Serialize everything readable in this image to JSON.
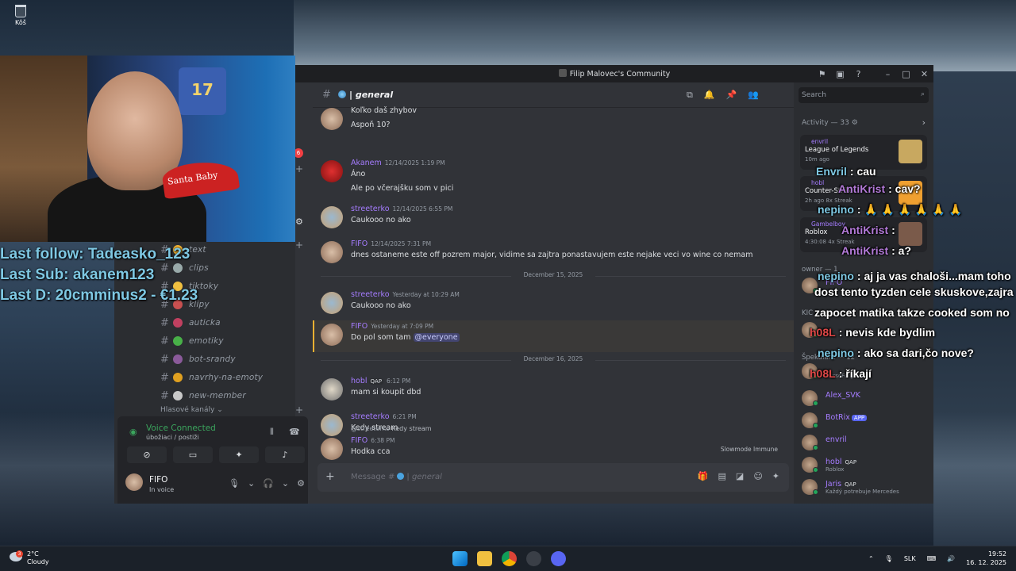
{
  "desktop": {
    "bin_label": "Kôš"
  },
  "webcam": {
    "hat_text": "Santa Baby",
    "shirt_number": "17"
  },
  "stream_overlay": {
    "last_follow": "Last follow: Tadeasko_123",
    "last_sub": "Last Sub: akanem123",
    "last_d": "Last D: 20cmminus2 - €1.23"
  },
  "window": {
    "title": "Filip Malovec's Community"
  },
  "channels": [
    {
      "name": "text",
      "color": "#f0b132"
    },
    {
      "name": "clips",
      "color": "#9aa"
    },
    {
      "name": "tiktoky",
      "color": "#f0c040"
    },
    {
      "name": "klipy",
      "color": "#c85050"
    },
    {
      "name": "auticka",
      "color": "#c04060"
    },
    {
      "name": "emotiky",
      "color": "#48b048"
    },
    {
      "name": "bot-srandy",
      "color": "#8a5a9a"
    },
    {
      "name": "navrhy-na-emoty",
      "color": "#e0a020"
    },
    {
      "name": "new-member",
      "color": "#c8c8c8"
    }
  ],
  "category": "Hlasové kanály",
  "badge_count": "6",
  "voice": {
    "status": "Voice Connected",
    "channel": "úbožiaci / postiži"
  },
  "user_panel": {
    "name": "FIFO",
    "status": "In voice"
  },
  "chat": {
    "channel": "| general",
    "messages": [
      {
        "text1": "Koľko daš zhybov",
        "text2": "Aspoň 10?"
      },
      {
        "user": "Akanem",
        "time": "12/14/2025 1:19 PM",
        "color": "#a57cff",
        "text1": "Áno",
        "text2": "Ale po včerajšku som v pici"
      },
      {
        "user": "streeterko",
        "time": "12/14/2025 6:55 PM",
        "color": "#a57cff",
        "text1": "Caukooo no ako"
      },
      {
        "user": "FIFO",
        "time": "12/14/2025 7:31 PM",
        "color": "#a57cff",
        "text1": "dnes ostaneme este off pozrem major, vidime sa zajtra ponastavujem este nejake veci vo wine co nemam"
      },
      {
        "date": "December 15, 2025"
      },
      {
        "user": "streeterko",
        "time": "Yesterday at 10:29 AM",
        "color": "#a57cff",
        "text1": "Caukooo no ako"
      },
      {
        "user": "FIFO",
        "time": "Yesterday at 7:09 PM",
        "color": "#a57cff",
        "text1": "Do pol som tam",
        "mention": "@everyone"
      },
      {
        "date": "December 16, 2025"
      },
      {
        "user": "hobl",
        "tag": "QAP",
        "time": "6:12 PM",
        "color": "#a57cff",
        "text1": "mam si koupit dbd"
      },
      {
        "user": "streeterko",
        "time": "6:21 PM",
        "color": "#a57cff",
        "text1": "Kedy stream"
      },
      {
        "reply_user": "@streeterko",
        "reply_text": "Kedy stream",
        "user": "FIFO",
        "time": "6:38 PM",
        "color": "#a57cff",
        "text1": "Hodka cca"
      }
    ],
    "slowmode": "Slowmode Immune",
    "composer_placeholder": "Message #",
    "composer_channel": "| general"
  },
  "activity": {
    "search_placeholder": "Search",
    "header": "Activity — 33",
    "cards": [
      {
        "user": "envril",
        "game": "League of Legends",
        "meta": "10m ago",
        "color": "#c8a860"
      },
      {
        "user": "hobl",
        "game": "Counter-Strike",
        "meta": "2h ago  8x Streak",
        "color": "#f0a030"
      },
      {
        "user": "Gambelboy",
        "game": "Roblox",
        "meta": "4:30:08  4x Streak",
        "color": "#7a5a4a"
      }
    ],
    "sections": {
      "owner": "owner — 1",
      "kick": "KIC",
      "spek": "Špekulant — 12"
    },
    "members": [
      {
        "name": "FIFO",
        "status": "",
        "color": "#a57cff"
      },
      {
        "name": "",
        "status": "",
        "color": "#dbdee1"
      },
      {
        "name": "",
        "status": "CurseForge",
        "color": "#dbdee1"
      },
      {
        "name": "Alex_SVK",
        "status": "",
        "color": "#a57cff"
      },
      {
        "name": "BotRix",
        "status": "",
        "color": "#a57cff",
        "app": "APP"
      },
      {
        "name": "envril",
        "status": "",
        "color": "#a57cff"
      },
      {
        "name": "hobl",
        "status": "Roblox",
        "color": "#a57cff",
        "tag": "QAP"
      },
      {
        "name": "Jaris",
        "status": "Každý potrebuje Mercedes",
        "color": "#a57cff",
        "tag": "QAP"
      }
    ]
  },
  "overlay_chat": [
    {
      "user": "Envril",
      "text": ": cau",
      "color": "#7ec8e3"
    },
    {
      "user": "AntiKrist",
      "text": ": cav?",
      "color": "#b37ad8"
    },
    {
      "user": "nepino",
      "text": ": 🙏 🙏 🙏 🙏 🙏 🙏",
      "color": "#7ec8e3"
    },
    {
      "user": "AntiKrist",
      "text": ":",
      "color": "#b37ad8"
    },
    {
      "user": "AntiKrist",
      "text": ": a?",
      "color": "#b37ad8"
    },
    {
      "user": "nepino",
      "text": ": aj ja vas chaloši...mam toho",
      "color": "#7ec8e3"
    },
    {
      "user": "",
      "text": "dost tento tyzden cele skuskove,zajra",
      "color": "#fff"
    },
    {
      "user": "",
      "text": "zapocet matika takze cooked som no",
      "color": "#fff"
    },
    {
      "user": "h08L",
      "text": ": nevis kde bydlim",
      "color": "#e04848"
    },
    {
      "user": "nepino",
      "text": ": ako sa dari,čo nove?",
      "color": "#7ec8e3"
    },
    {
      "user": "h08L",
      "text": ": říkají",
      "color": "#e04848"
    }
  ],
  "taskbar": {
    "temp": "2°C",
    "weather": "Cloudy",
    "weather_badge": "3",
    "lang": "SLK",
    "time": "19:52",
    "date": "16. 12. 2025"
  }
}
